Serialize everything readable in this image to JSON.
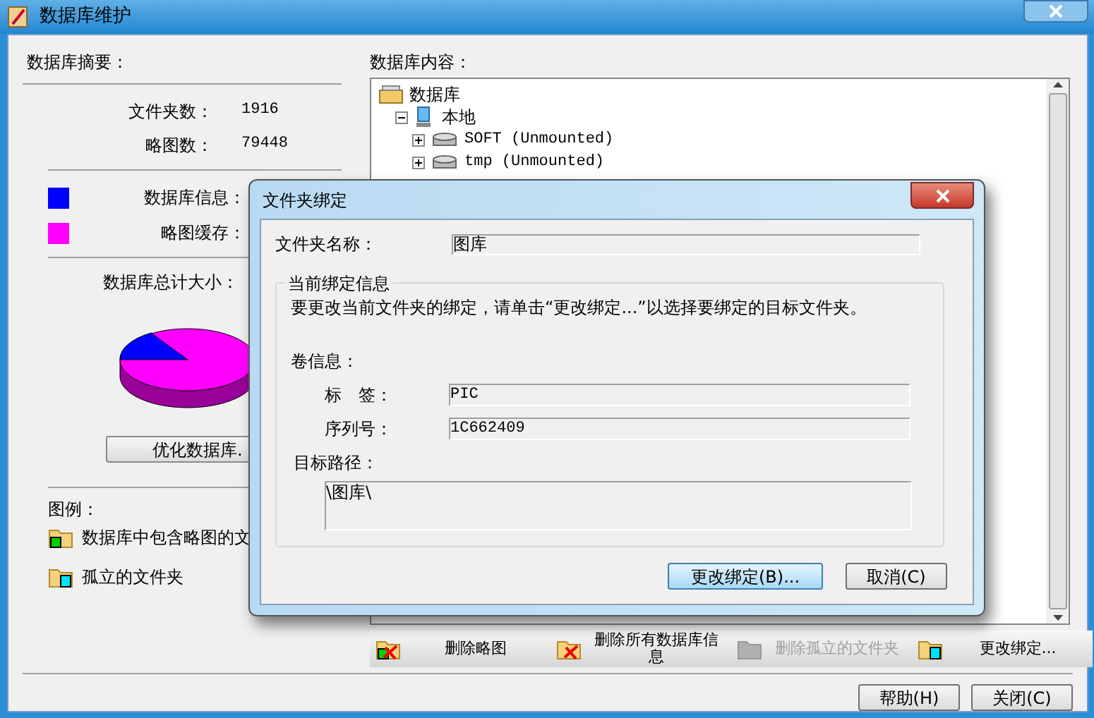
{
  "window": {
    "title": "数据库维护"
  },
  "summary": {
    "heading": "数据库摘要：",
    "stats": [
      {
        "label": "文件夹数：",
        "value": "1916"
      },
      {
        "label": "略图数：",
        "value": "79448"
      }
    ],
    "sizes": [
      {
        "label": "数据库信息：",
        "color": "#0000ff"
      },
      {
        "label": "略图缓存：",
        "color": "#ff00ff"
      }
    ],
    "total_label": "数据库总计大小：",
    "optimize_button": "优化数据库."
  },
  "legend": {
    "heading": "图例：",
    "items": [
      {
        "kind": "thumbs",
        "label": "数据库中包含略图的文"
      },
      {
        "kind": "orphan",
        "label": "孤立的文件夹"
      }
    ]
  },
  "contents": {
    "heading": "数据库内容：",
    "tree": [
      {
        "kind": "root",
        "label": "数据库",
        "children": [
          {
            "kind": "computer",
            "label": "本地",
            "expanded": true,
            "children": [
              {
                "kind": "drive",
                "label": "SOFT (Unmounted)",
                "expanded": false
              },
              {
                "kind": "drive",
                "label": "tmp (Unmounted)",
                "expanded": false
              }
            ]
          }
        ]
      }
    ]
  },
  "actions": [
    {
      "kind": "delete-thumbs",
      "label": "删除略图",
      "disabled": false
    },
    {
      "kind": "delete-all",
      "label": "删除所有数据库信息",
      "disabled": false
    },
    {
      "kind": "delete-orphan",
      "label": "删除孤立的文件夹",
      "disabled": true
    },
    {
      "kind": "rebind",
      "label": "更改绑定...",
      "disabled": false
    }
  ],
  "buttons": [
    "帮助(H)",
    "关闭(C)"
  ],
  "dialog": {
    "title": "文件夹绑定",
    "folder_name_label": "文件夹名称：",
    "folder_name": "图库",
    "group_title": "当前绑定信息",
    "instruction": "要更改当前文件夹的绑定，请单击“更改绑定...”以选择要绑定的目标文件夹。",
    "volume_heading": "卷信息：",
    "fields": [
      {
        "label": "标　签：",
        "value": "PIC"
      },
      {
        "label": "序列号：",
        "value": "1C662409"
      }
    ],
    "path_label": "目标路径：",
    "path": "\\图库\\",
    "buttons": [
      {
        "label": "更改绑定(B)...",
        "default": true
      },
      {
        "label": "取消(C)",
        "default": false
      }
    ]
  }
}
